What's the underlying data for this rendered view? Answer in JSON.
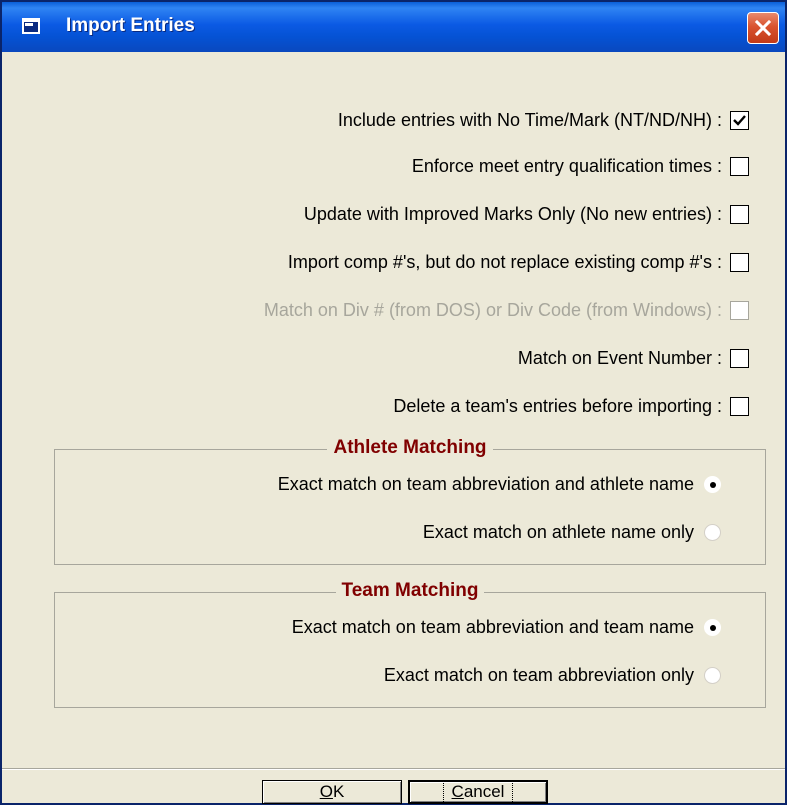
{
  "window": {
    "title": "Import Entries"
  },
  "options": [
    {
      "label": "Include entries with No Time/Mark (NT/ND/NH) :",
      "checked": true,
      "enabled": true
    },
    {
      "label": "Enforce meet entry qualification times :",
      "checked": false,
      "enabled": true
    },
    {
      "label": "Update with Improved Marks Only (No new entries) :",
      "checked": false,
      "enabled": true
    },
    {
      "label": "Import comp #'s, but do not replace existing comp #'s :",
      "checked": false,
      "enabled": true
    },
    {
      "label": "Match on Div # (from DOS) or Div Code (from Windows) :",
      "checked": false,
      "enabled": false
    },
    {
      "label": "Match on Event Number :",
      "checked": false,
      "enabled": true
    },
    {
      "label": "Delete a team's entries before importing :",
      "checked": false,
      "enabled": true
    }
  ],
  "athlete_matching": {
    "title": "Athlete Matching",
    "options": [
      {
        "label": "Exact match on team abbreviation and athlete name",
        "selected": true
      },
      {
        "label": "Exact match on athlete name only",
        "selected": false
      }
    ]
  },
  "team_matching": {
    "title": "Team Matching",
    "options": [
      {
        "label": "Exact match on team abbreviation and team name",
        "selected": true
      },
      {
        "label": "Exact match on team abbreviation only",
        "selected": false
      }
    ]
  },
  "buttons": {
    "ok_label_mnemonic": "O",
    "ok_label_rest": "K",
    "cancel_label_mnemonic": "C",
    "cancel_label_rest": "ancel"
  },
  "colors": {
    "titlebar": "#0552d4",
    "group_title": "#800000",
    "dialog_bg": "#ece9d8"
  }
}
